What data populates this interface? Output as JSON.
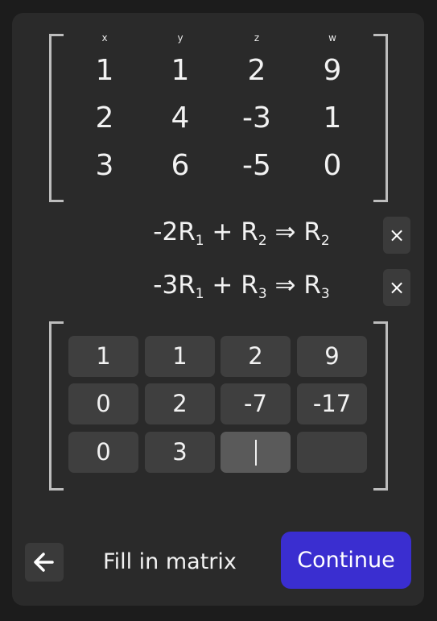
{
  "matrix": {
    "headers": [
      "x",
      "y",
      "z",
      "w"
    ],
    "rows": [
      [
        "1",
        "1",
        "2",
        "9"
      ],
      [
        "2",
        "4",
        "-3",
        "1"
      ],
      [
        "3",
        "6",
        "-5",
        "0"
      ]
    ]
  },
  "operations": [
    {
      "coef": "-2",
      "src": "1",
      "dst": "2",
      "remove": "×"
    },
    {
      "coef": "-3",
      "src": "1",
      "dst": "3",
      "remove": "×"
    }
  ],
  "row_symbol": "R",
  "plus": "+",
  "implies": "⇒",
  "input_matrix": [
    [
      "1",
      "1",
      "2",
      "9"
    ],
    [
      "0",
      "2",
      "-7",
      "-17"
    ],
    [
      "0",
      "3",
      "",
      ""
    ]
  ],
  "footer": {
    "status": "Fill in matrix",
    "continue_label": "Continue",
    "back_icon": "arrow-left-icon"
  },
  "colors": {
    "primary": "#3a2ed0",
    "card": "#2a2a2a",
    "background": "#1c1c1c"
  }
}
